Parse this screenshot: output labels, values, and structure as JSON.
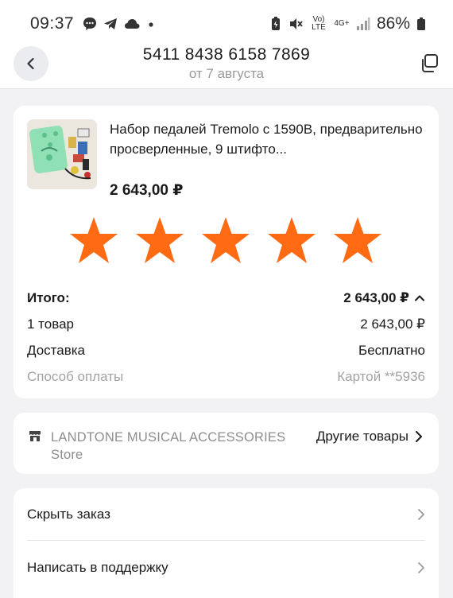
{
  "status_bar": {
    "time": "09:37",
    "volte": "Vo) LTE",
    "network": "4G+",
    "battery": "86%"
  },
  "header": {
    "order_number": "5411 8438 6158 7869",
    "order_date": "от 7 августа"
  },
  "product": {
    "title": "Набор педалей Tremolo с 1590B, предварительно просверленные, 9 штифто...",
    "price": "2 643,00 ₽",
    "rating": 5,
    "star_color": "#ff6a13"
  },
  "summary": {
    "total_label": "Итого:",
    "total_value": "2 643,00 ₽",
    "items_label": "1 товар",
    "items_value": "2 643,00 ₽",
    "delivery_label": "Доставка",
    "delivery_value": "Бесплатно",
    "payment_label": "Способ оплаты",
    "payment_value": "Картой **5936"
  },
  "store": {
    "name": "LANDTONE MUSICAL ACCESSORIES Store",
    "link_label": "Другие товары"
  },
  "actions": {
    "hide_label": "Скрыть заказ",
    "support_label": "Написать в поддержку"
  }
}
